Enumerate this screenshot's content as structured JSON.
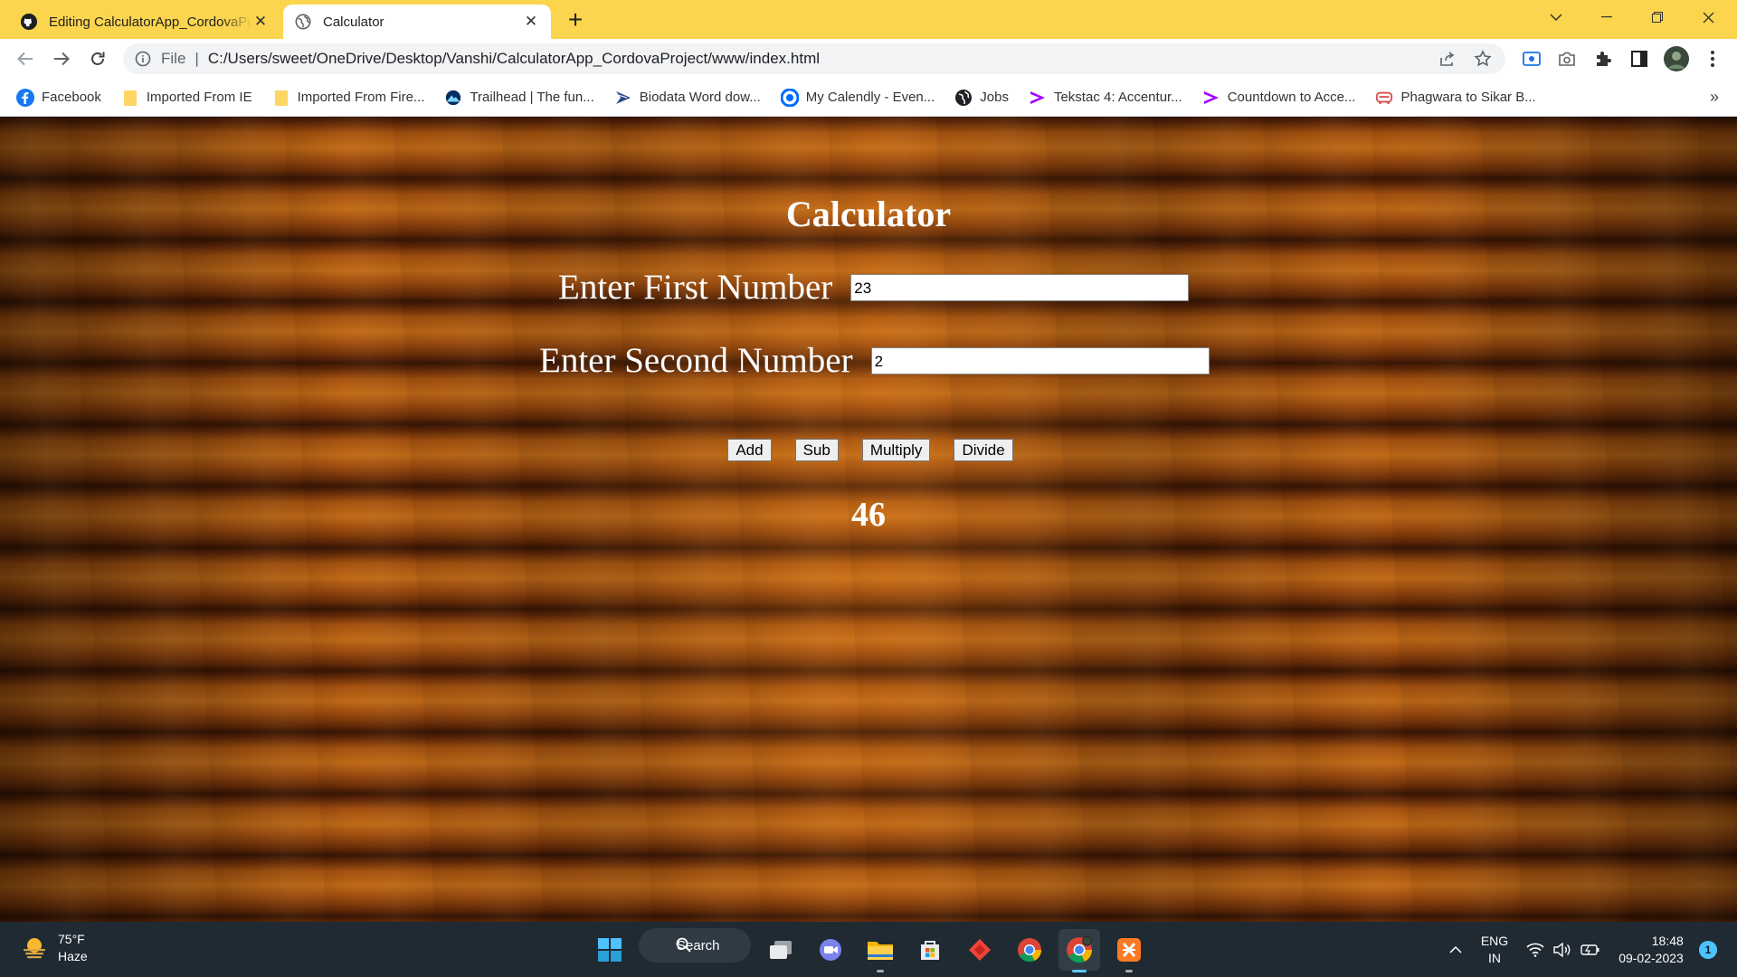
{
  "browser": {
    "tabs": [
      {
        "title": "Editing CalculatorApp_CordovaProject",
        "close": "✕"
      },
      {
        "title": "Calculator",
        "close": "✕"
      }
    ],
    "new_tab": "+",
    "window_controls": {
      "dropdown": "⌄",
      "minimize": "—",
      "restore": "❐",
      "close": "✕"
    },
    "address": {
      "scheme": "File",
      "separator": "|",
      "url": "C:/Users/sweet/OneDrive/Desktop/Vanshi/CalculatorApp_CordovaProject/www/index.html"
    },
    "bookmarks": [
      {
        "label": "Facebook",
        "icon": "facebook-icon"
      },
      {
        "label": "Imported From IE",
        "icon": "folder-icon"
      },
      {
        "label": "Imported From Fire...",
        "icon": "folder-icon"
      },
      {
        "label": "Trailhead | The fun...",
        "icon": "trailhead-icon"
      },
      {
        "label": "Biodata Word dow...",
        "icon": "biodata-icon"
      },
      {
        "label": "My Calendly - Even...",
        "icon": "calendly-icon"
      },
      {
        "label": "Jobs",
        "icon": "globe-icon"
      },
      {
        "label": "Tekstac 4: Accentur...",
        "icon": "accenture-icon"
      },
      {
        "label": "Countdown to Acce...",
        "icon": "accenture-icon"
      },
      {
        "label": "Phagwara to Sikar B...",
        "icon": "bus-icon"
      }
    ],
    "bookmarks_more": "»"
  },
  "calculator": {
    "title": "Calculator",
    "first_label": "Enter First Number",
    "first_value": "23",
    "second_label": "Enter Second Number",
    "second_value": "2",
    "buttons": {
      "add": "Add",
      "sub": "Sub",
      "multiply": "Multiply",
      "divide": "Divide"
    },
    "result": "46"
  },
  "taskbar": {
    "weather": {
      "temp": "75°F",
      "condition": "Haze"
    },
    "search_label": "Search",
    "language": {
      "line1": "ENG",
      "line2": "IN"
    },
    "clock": {
      "time": "18:48",
      "date": "09-02-2023"
    },
    "notification_count": "1"
  },
  "colors": {
    "tabstrip": "#fbd54d",
    "taskbar": "#1f2a33",
    "page_text": "#ffffff"
  }
}
